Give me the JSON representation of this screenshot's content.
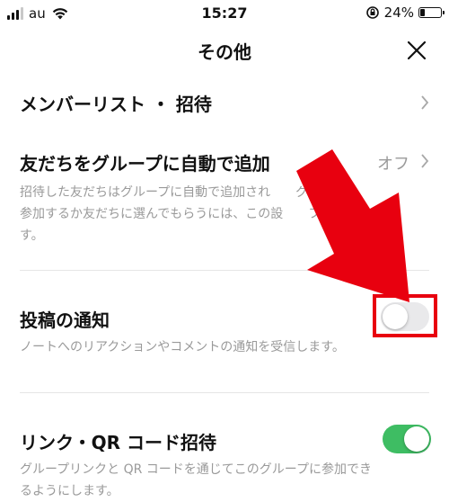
{
  "status_bar": {
    "carrier": "au",
    "time": "15:27",
    "battery": "24%",
    "battery_level": 0.24
  },
  "header": {
    "title": "その他"
  },
  "rows": {
    "members": {
      "title": "メンバーリスト ・ 招待"
    },
    "auto_add": {
      "title": "友だちをグループに自動で追加",
      "value": "オフ",
      "desc_line1": "招待した友だちはグループに自動で追加され　　グループに",
      "desc_line2": "参加するか友だちに選んでもらうには、この設　　フにしま",
      "desc_line3": "す。"
    },
    "post_notify": {
      "title": "投稿の通知",
      "desc": "ノートへのリアクションやコメントの通知を受信します。",
      "enabled": false
    },
    "link_qr": {
      "title": "リンク・QR コード招待",
      "desc_line1": "グループリンクと QR コードを通じてこのグループに参加でき",
      "desc_line2": "るようにします。",
      "enabled": true
    }
  },
  "annotations": {
    "arrow_color": "#e8000f",
    "highlight_color": "#e8000f"
  },
  "colors": {
    "toggle_on": "#3ebd63",
    "toggle_off": "#e9e9eb"
  }
}
